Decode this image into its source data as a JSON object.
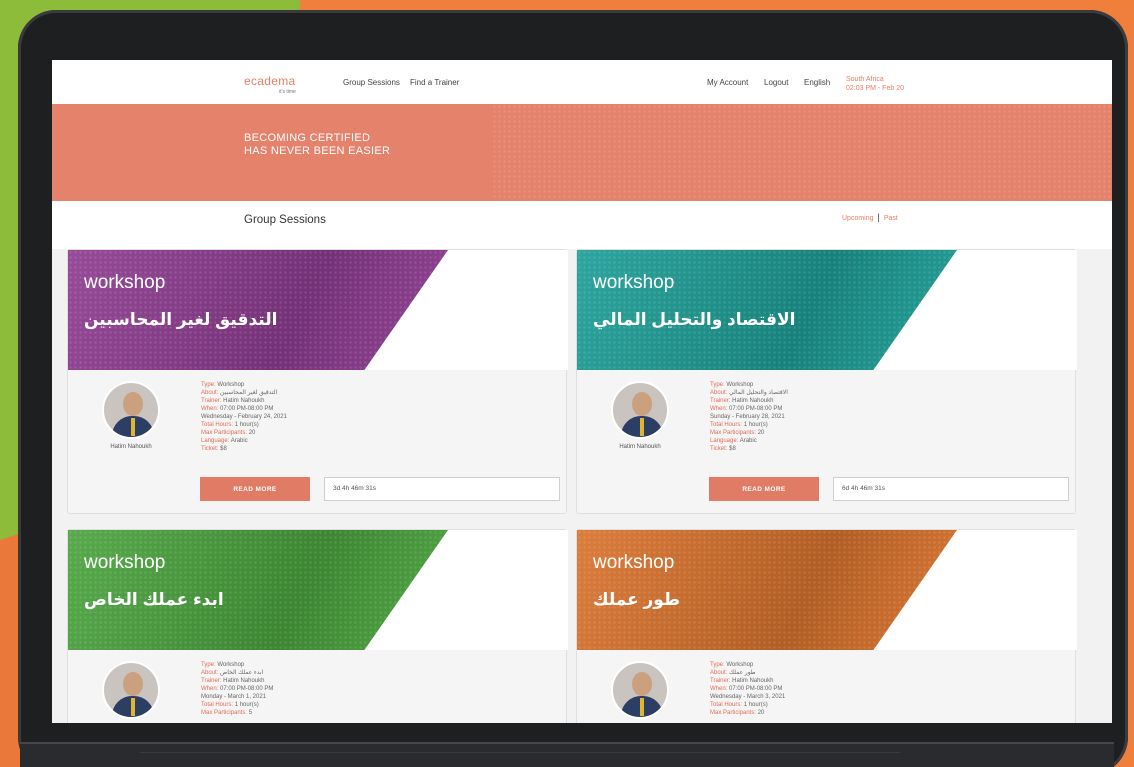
{
  "nav": {
    "logo": "ecadema",
    "logo_tagline": "it's time",
    "links": [
      "Group Sessions",
      "Find a Trainer"
    ],
    "right_links": [
      "My Account",
      "Logout",
      "English"
    ],
    "location_line1": "South Africa",
    "location_line2": "02:03 PM - Feb 20"
  },
  "hero": {
    "line1": "BECOMING CERTIFIED",
    "line2": "HAS NEVER BEEN EASIER"
  },
  "section": {
    "title": "Group Sessions",
    "filter_upcoming": "Upcoming",
    "filter_sep": "|",
    "filter_past": "Past"
  },
  "cards": [
    {
      "banner_type": "workshop",
      "banner_title": "التدقيق لغير المحاسبين",
      "color": "#8e3c91",
      "trainer_name": "Hatim Nahoukh",
      "type_label": "Type:",
      "type_value": "Workshop",
      "about_label": "About:",
      "about_value": "التدقيق لغير المحاسبين",
      "trainer_label": "Trainer:",
      "trainer_value": "Hatim Nahoukh",
      "when_label": "When:",
      "when_value": "07:00 PM-08:00 PM",
      "date_value": "Wednesday - February 24, 2021",
      "hours_label": "Total Hours:",
      "hours_value": "1 hour(s)",
      "max_label": "Max Participants:",
      "max_value": "20",
      "lang_label": "Language:",
      "lang_value": "Arabic",
      "ticket_label": "Ticket:",
      "ticket_value": "$8",
      "button": "READ MORE",
      "countdown": "3d 4h 46m 31s"
    },
    {
      "banner_type": "workshop",
      "banner_title": "الاقتصاد والتحليل المالي",
      "color": "#1c9e96",
      "trainer_name": "Hatim Nahoukh",
      "type_label": "Type:",
      "type_value": "Workshop",
      "about_label": "About:",
      "about_value": "الاقتصاد والتحليل المالي",
      "trainer_label": "Trainer:",
      "trainer_value": "Hatim Nahoukh",
      "when_label": "When:",
      "when_value": "07:00 PM-08:00 PM",
      "date_value": "Sunday - February 28, 2021",
      "hours_label": "Total Hours:",
      "hours_value": "1 hour(s)",
      "max_label": "Max Participants:",
      "max_value": "20",
      "lang_label": "Language:",
      "lang_value": "Arabic",
      "ticket_label": "Ticket:",
      "ticket_value": "$8",
      "button": "READ MORE",
      "countdown": "6d 4h 46m 31s"
    },
    {
      "banner_type": "workshop",
      "banner_title": "ابدء عملك الخاص",
      "color": "#4aa33d",
      "trainer_name": "Hatim Nahoukh",
      "type_label": "Type:",
      "type_value": "Workshop",
      "about_label": "About:",
      "about_value": "ابدء عملك الخاص",
      "trainer_label": "Trainer:",
      "trainer_value": "Hatim Nahoukh",
      "when_label": "When:",
      "when_value": "07:00 PM-08:00 PM",
      "date_value": "Monday - March 1, 2021",
      "hours_label": "Total Hours:",
      "hours_value": "1 hour(s)",
      "max_label": "Max Participants:",
      "max_value": "5"
    },
    {
      "banner_type": "workshop",
      "banner_title": "طور عملك",
      "color": "#d9722c",
      "trainer_name": "Hatim Nahoukh",
      "type_label": "Type:",
      "type_value": "Workshop",
      "about_label": "About:",
      "about_value": "طور عملك",
      "trainer_label": "Trainer:",
      "trainer_value": "Hatim Nahoukh",
      "when_label": "When:",
      "when_value": "07:00 PM-08:00 PM",
      "date_value": "Wednesday - March 3, 2021",
      "hours_label": "Total Hours:",
      "hours_value": "1 hour(s)",
      "max_label": "Max Participants:",
      "max_value": "20"
    }
  ]
}
